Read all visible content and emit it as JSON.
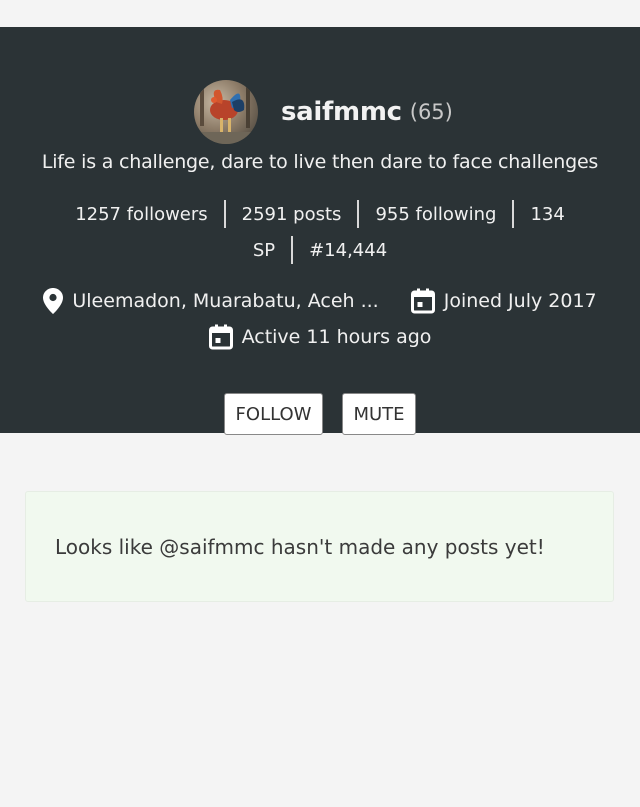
{
  "profile": {
    "username": "saifmmc",
    "reputation": "(65)",
    "bio": "Life is a challenge, dare to live then dare to face challenges",
    "stats": {
      "followers": "1257 followers",
      "posts": "2591 posts",
      "following": "955 following",
      "sp_part1": "134",
      "sp_part2": "SP",
      "rank": "#14,444"
    },
    "location": "Uleemadon, Muarabatu, Aceh ...",
    "joined": "Joined July 2017",
    "active": "Active 11 hours ago",
    "buttons": {
      "follow": "FOLLOW",
      "mute": "MUTE"
    }
  },
  "empty_message": "Looks like @saifmmc hasn't made any posts yet!",
  "colors": {
    "header_bg": "#2b3336",
    "empty_box_bg": "#f1f9ef",
    "page_bg": "#f4f4f4"
  }
}
